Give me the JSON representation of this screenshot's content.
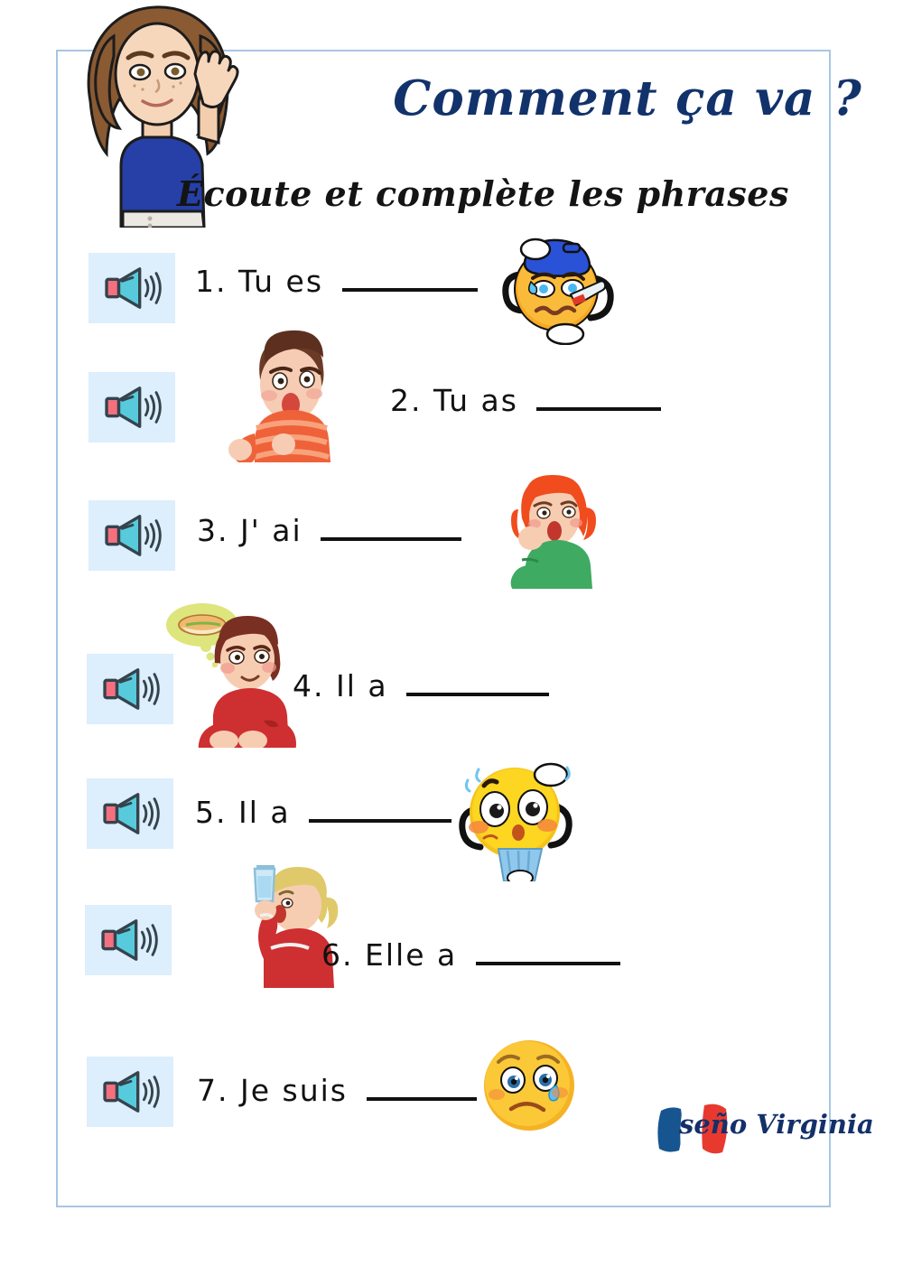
{
  "worksheet": {
    "title": "Comment ça va ?",
    "subtitle": "Écoute et complète les phrases",
    "title_color": "#12326b",
    "border_color": "#a8c6e2",
    "speaker_bg": "#ddeefc",
    "speaker_cone_color": "#57cbdc",
    "speaker_body_color": "#f4707e"
  },
  "avatar": {
    "name": "teacher-bitmoji-listening",
    "hair_color": "#8a5a32",
    "shirt_color": "#2640a8",
    "skin_color": "#f2cdae"
  },
  "exercises": [
    {
      "number": "1.",
      "text": "Tu es",
      "blank_width": 150,
      "speaker_label": "play-audio-1",
      "image": "sick-emoji-ice-pack-thermometer"
    },
    {
      "number": "2.",
      "text": "Tu as",
      "blank_width": 138,
      "speaker_label": "play-audio-2",
      "image": "boy-coughing-orange-striped-shirt"
    },
    {
      "number": "3.",
      "text": "J' ai",
      "blank_width": 156,
      "speaker_label": "play-audio-3",
      "image": "woman-yawning-red-hair-green-sweater"
    },
    {
      "number": "4.",
      "text": "Il a",
      "blank_width": 158,
      "speaker_label": "play-audio-4",
      "image": "boy-hungry-sandwich-thought-bubble"
    },
    {
      "number": "5.",
      "text": "Il a",
      "blank_width": 158,
      "speaker_label": "play-audio-5",
      "image": "hot-emoji-with-fan"
    },
    {
      "number": "6.",
      "text": "Elle a",
      "blank_width": 160,
      "speaker_label": "play-audio-6",
      "image": "girl-drinking-water-red-sweater"
    },
    {
      "number": "7.",
      "text": "Je suis",
      "blank_width": 122,
      "speaker_label": "play-audio-7",
      "image": "sad-crying-emoji"
    }
  ],
  "logo": {
    "text": "seño Virginia",
    "flag_blue": "#16558f",
    "flag_red": "#e8392f",
    "text_color": "#13306a"
  }
}
